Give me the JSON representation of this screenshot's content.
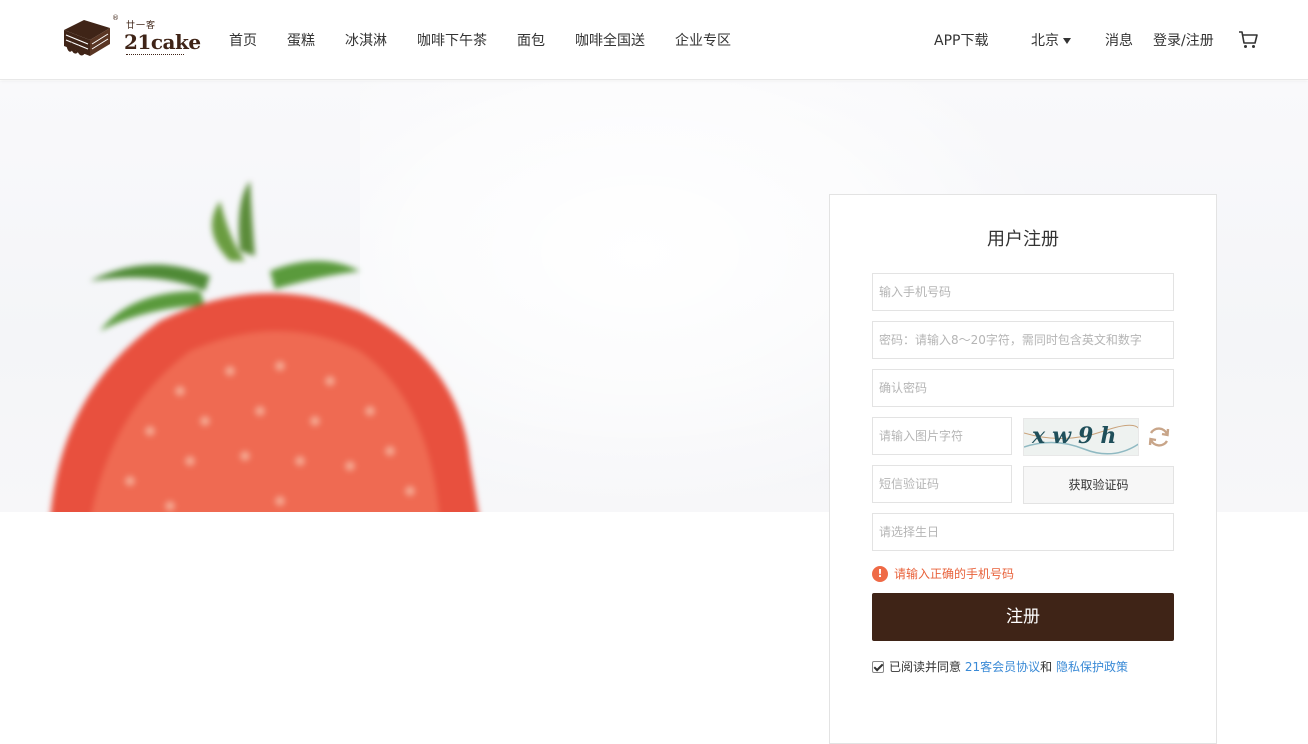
{
  "header": {
    "logo": {
      "brand_cn": "廿一客",
      "brand_en": "21cake",
      "registered": "®"
    },
    "nav": [
      "首页",
      "蛋糕",
      "冰淇淋",
      "咖啡下午茶",
      "面包",
      "咖啡全国送",
      "企业专区"
    ],
    "app_download": "APP下载",
    "city": "北京",
    "messages": "消息",
    "login_register": "登录/注册",
    "cart_icon": "cart-icon"
  },
  "form": {
    "title": "用户注册",
    "phone_placeholder": "输入手机号码",
    "password_placeholder": "密码：请输入8～20字符，需同时包含英文和数字",
    "confirm_placeholder": "确认密码",
    "captcha_placeholder": "请输入图片字符",
    "captcha_text": "xw9h",
    "sms_placeholder": "短信验证码",
    "sms_button": "获取验证码",
    "birthday_placeholder": "请选择生日",
    "error_message": "请输入正确的手机号码",
    "error_icon": "!",
    "submit": "注册",
    "agree_prefix": "已阅读并同意 ",
    "agreement_link": "21客会员协议",
    "and": "和 ",
    "privacy_link": "隐私保护政策",
    "agree_checked": true
  },
  "colors": {
    "brand": "#3f2417",
    "error": "#e8613a",
    "link": "#3a8ad6"
  }
}
